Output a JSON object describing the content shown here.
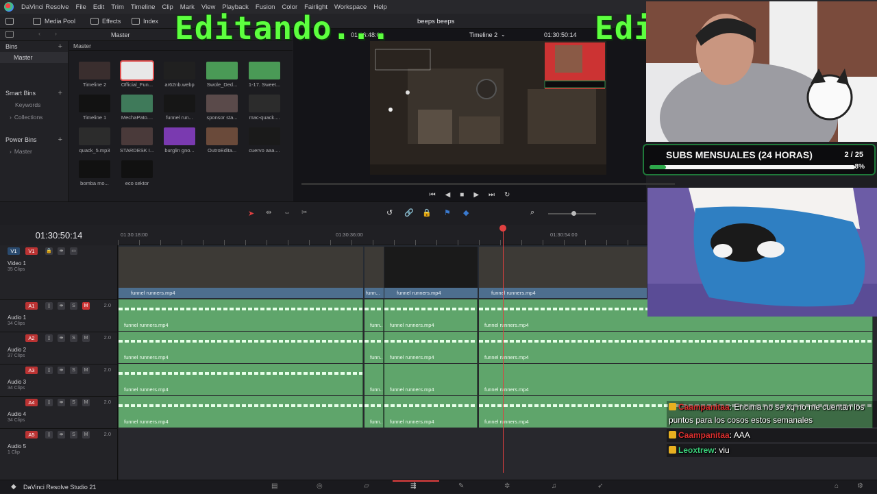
{
  "menubar": {
    "app_name": "DaVinci Resolve",
    "items": [
      "File",
      "Edit",
      "Trim",
      "Timeline",
      "Clip",
      "Mark",
      "View",
      "Playback",
      "Fusion",
      "Color",
      "Fairlight",
      "Workspace",
      "Help"
    ]
  },
  "toolbar": {
    "media_pool": "Media Pool",
    "effects": "Effects",
    "index": "Index",
    "project_title": "beeps beeps",
    "timeline_name": "Timeline 2",
    "viewer_timecode": "01:30:50:14",
    "source_timecode": "01:16:48:09",
    "crumb": "Master"
  },
  "left_panel": {
    "bins_label": "Bins",
    "master": "Master",
    "smart_bins": "Smart Bins",
    "keywords": "Keywords",
    "collections": "Collections",
    "power_bins": "Power Bins",
    "power_master": "Master"
  },
  "media_pool": {
    "crumb": "Master",
    "clips": [
      {
        "name": "Timeline 2",
        "color": "#3a2e2e"
      },
      {
        "name": "Official_Fun...",
        "color": "#e8e8e8"
      },
      {
        "name": "ar62nb.webp",
        "color": "#202020"
      },
      {
        "name": "Swole_Ded...",
        "color": "#4a9a56"
      },
      {
        "name": "1-17. Sweet...",
        "color": "#4a9a56"
      },
      {
        "name": "Timeline 1",
        "color": "#121212"
      },
      {
        "name": "MechaPato....",
        "color": "#3f7a5a"
      },
      {
        "name": "funnel run...",
        "color": "#161616"
      },
      {
        "name": "sponsor sta...",
        "color": "#5a4a4a"
      },
      {
        "name": "mac-quack....",
        "color": "#2c2c2c"
      },
      {
        "name": "quack_5.mp3",
        "color": "#2c2c2c"
      },
      {
        "name": "STARDESK I...",
        "color": "#4a3a3a"
      },
      {
        "name": "burglin gno...",
        "color": "#7a3ab0"
      },
      {
        "name": "OutroEdita...",
        "color": "#6a4a3a"
      },
      {
        "name": "cuervo aaa....",
        "color": "#1a1a1a"
      },
      {
        "name": "bomba mo...",
        "color": "#111111"
      },
      {
        "name": "eco sektor",
        "color": "#111111"
      }
    ]
  },
  "timeline": {
    "timecode": "01:30:50:14",
    "ruler": [
      "01:30:18:00",
      "01:30:36:00",
      "01:30:54:00"
    ],
    "tracks": [
      {
        "tag": "V1",
        "name": "Video 1",
        "count": "35 Clips",
        "color": "#4a78a8"
      },
      {
        "tag": "A1",
        "name": "Audio 1",
        "count": "34 Clips",
        "vol": "2.0"
      },
      {
        "tag": "A2",
        "name": "Audio 2",
        "count": "37 Clips",
        "vol": "2.0"
      },
      {
        "tag": "A3",
        "name": "Audio 3",
        "count": "34 Clips",
        "vol": "2.0"
      },
      {
        "tag": "A4",
        "name": "Audio 4",
        "count": "34 Clips",
        "vol": "2.0"
      },
      {
        "tag": "A5",
        "name": "Audio 5",
        "count": "1 Clip",
        "vol": "2.0"
      }
    ],
    "video_clips": [
      "funnel runners.mp4",
      "funn...",
      "funnel runners.mp4",
      "funnel runners.mp4"
    ],
    "audio_clip_label": "funnel runners.mp4",
    "audio_short_label": "funn..."
  },
  "stream": {
    "overlay_left": "Editando...",
    "overlay_right": "Edi",
    "subs_title": "SUBS MENSUALES (24 HORAS)",
    "subs_count": "2 / 25",
    "subs_percent": "8%",
    "subs_progress": 0.08,
    "chat": [
      {
        "user": "Caampanitaa",
        "user_color": "#e03030",
        "text": ": Encima no se xq no me cuentan los puntos para los cosos estos semanales"
      },
      {
        "user": "Caampanitaa",
        "user_color": "#e03030",
        "text": ": AAA"
      },
      {
        "user": "Leoxtrew",
        "user_color": "#3ad07a",
        "text": ": viu"
      }
    ]
  },
  "bottom": {
    "brand": "DaVinci Resolve Studio 21"
  }
}
